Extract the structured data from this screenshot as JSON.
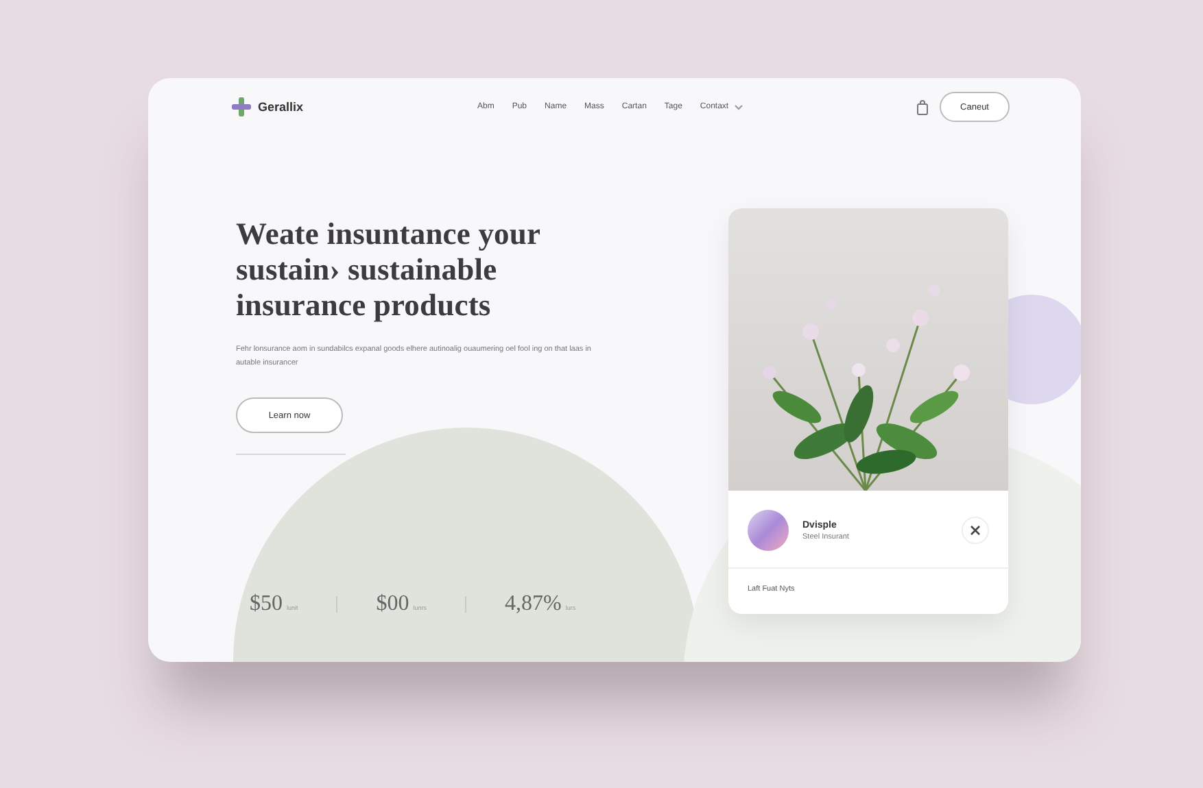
{
  "brand": {
    "name": "Gerallix"
  },
  "nav": {
    "items": [
      {
        "label": "Abm",
        "kind": "link"
      },
      {
        "label": "Pub",
        "kind": "link"
      },
      {
        "label": "Name",
        "kind": "link"
      },
      {
        "label": "Mass",
        "kind": "link"
      },
      {
        "label": "Cartan",
        "kind": "link"
      },
      {
        "label": "Tage",
        "kind": "link"
      },
      {
        "label": "Contaxt",
        "kind": "dropdown"
      }
    ],
    "button": "Caneut"
  },
  "hero": {
    "title_lines": [
      "Weate insuntance your",
      "sustain› sustainable",
      "insurance products"
    ],
    "paragraph": "Fehr lonsurance aom in sundabilcs expanal goods elhere autinoalig ouaumering oel fool ing on that laas in autable insurancer",
    "button": "Learn now"
  },
  "stats": [
    {
      "value": "$50",
      "unit": "lunit"
    },
    {
      "value": "$00",
      "unit": "lunrs"
    },
    {
      "value": "4,87%",
      "unit": "lurs"
    }
  ],
  "profile_card": {
    "name": "Dvisple",
    "subtitle": "Steel Insurant",
    "footer": "Laft Fuat Nyts"
  }
}
